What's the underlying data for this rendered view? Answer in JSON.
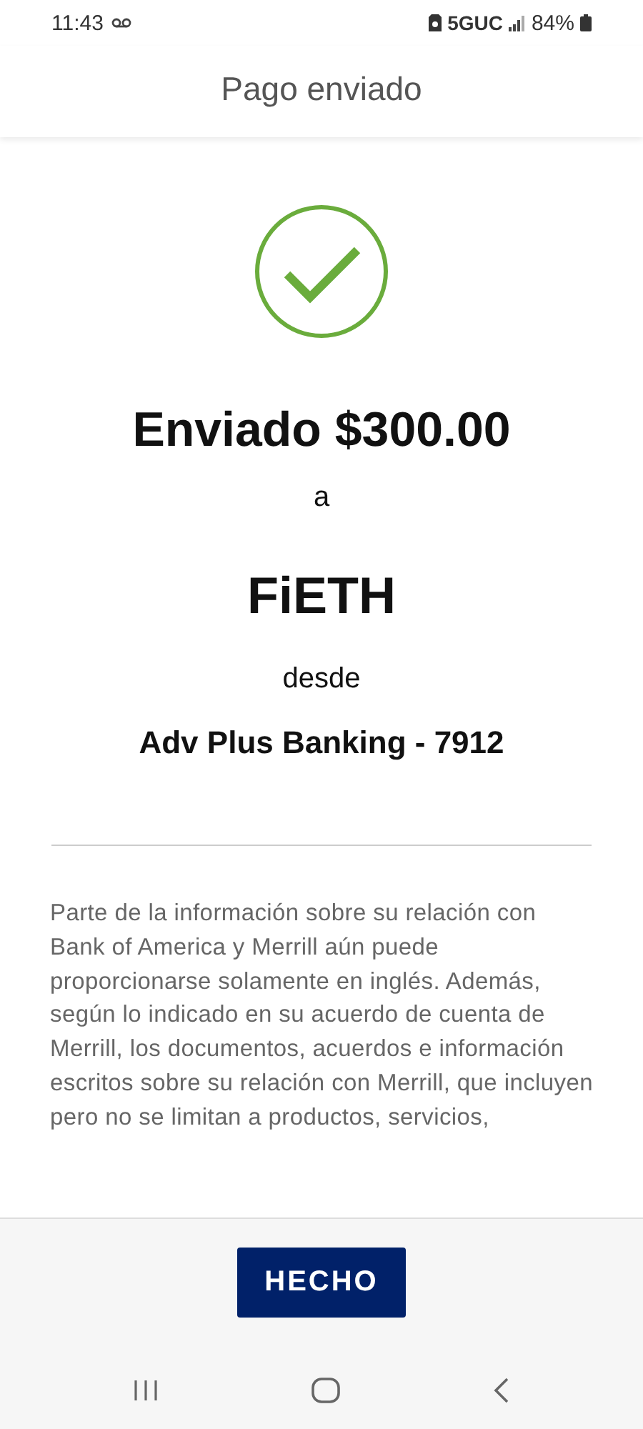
{
  "status_bar": {
    "time": "11:43",
    "network": "5GUC",
    "battery": "84%"
  },
  "header": {
    "title": "Pago enviado"
  },
  "confirmation": {
    "amount_line": "Enviado $300.00",
    "to_word": "a",
    "recipient": "FiETH",
    "from_word": "desde",
    "account": "Adv Plus Banking - 7912"
  },
  "disclaimer": "Parte de la información sobre su relación con Bank of America y Merrill aún puede proporcionarse solamente en inglés. Además, según lo indicado en su acuerdo de cuenta de Merrill, los documentos, acuerdos e información escritos sobre su relación con Merrill, que incluyen pero no se limitan a productos, servicios,",
  "footer": {
    "button": "HECHO"
  }
}
